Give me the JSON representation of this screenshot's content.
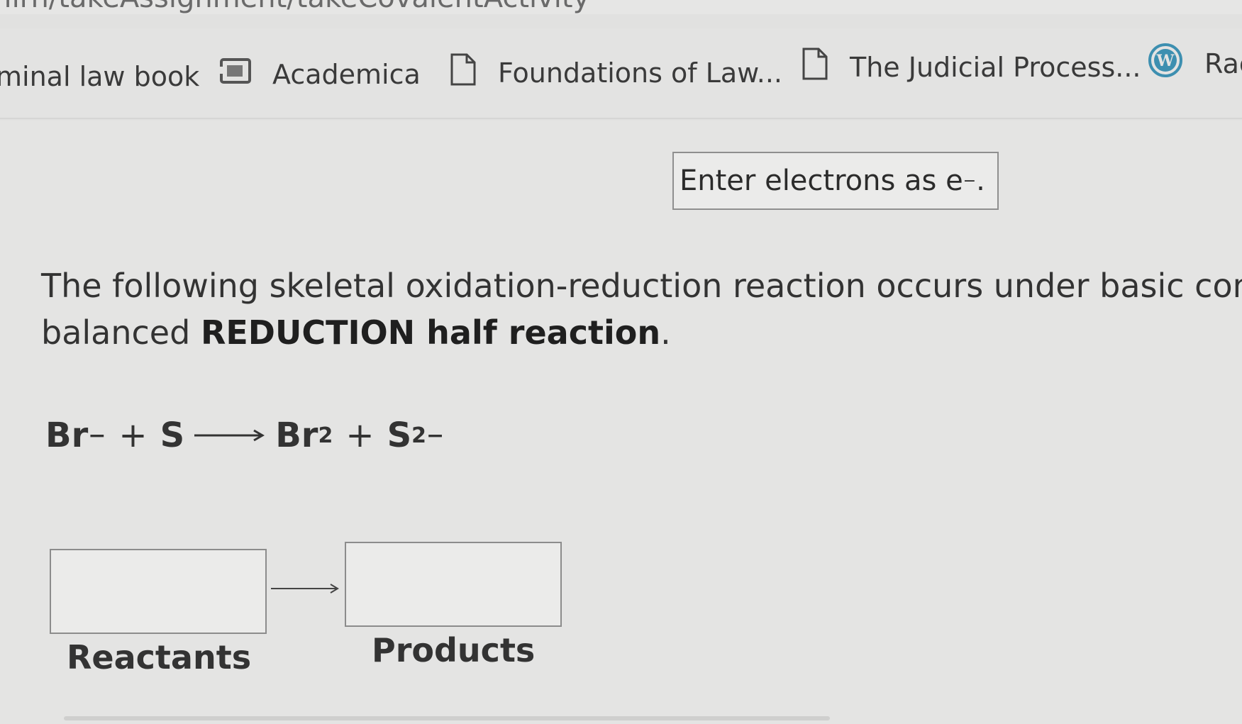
{
  "browser": {
    "url_fragment": "/ilrn/takeAssignment/takeCovalentActivity",
    "bookmarks": [
      {
        "label": "minal law book",
        "icon": "none"
      },
      {
        "label": "Academica",
        "icon": "academica-icon"
      },
      {
        "label": "Foundations of Law...",
        "icon": "page-icon"
      },
      {
        "label": "The Judicial Process...",
        "icon": "page-icon"
      },
      {
        "label": "Rac",
        "icon": "wordpress-icon"
      }
    ]
  },
  "question": {
    "hint_text": "Enter electrons as e",
    "hint_sup": "−",
    "hint_period": ".",
    "line1": "The following skeletal oxidation-reduction reaction occurs under basic cond",
    "line2_prefix": "balanced ",
    "line2_bold": "REDUCTION half reaction",
    "line2_suffix": "."
  },
  "equation": {
    "reactant1": "Br",
    "reactant1_charge": "−",
    "plus1": "+",
    "reactant2": "S",
    "product1": "Br",
    "product1_sub": "2",
    "plus2": "+",
    "product2": "S",
    "product2_charge": "2−"
  },
  "answer": {
    "reactants_label": "Reactants",
    "products_label": "Products",
    "reactants_value": "",
    "products_value": ""
  },
  "colors": {
    "background": "#e4e4e3",
    "text": "#333333",
    "box_border": "#8c8c8c",
    "wordpress_icon": "#3d8fb0"
  }
}
